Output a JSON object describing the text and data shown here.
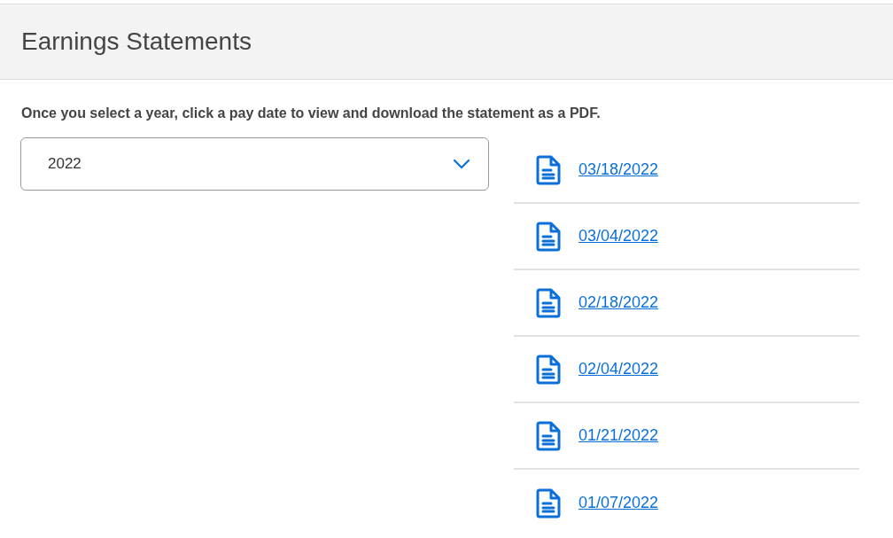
{
  "header": {
    "title": "Earnings Statements"
  },
  "instructions": "Once you select a year, click a pay date to view and download the statement as a PDF.",
  "year_select": {
    "value": "2022"
  },
  "statements": [
    {
      "date": "03/18/2022"
    },
    {
      "date": "03/04/2022"
    },
    {
      "date": "02/18/2022"
    },
    {
      "date": "02/04/2022"
    },
    {
      "date": "01/21/2022"
    },
    {
      "date": "01/07/2022"
    }
  ]
}
